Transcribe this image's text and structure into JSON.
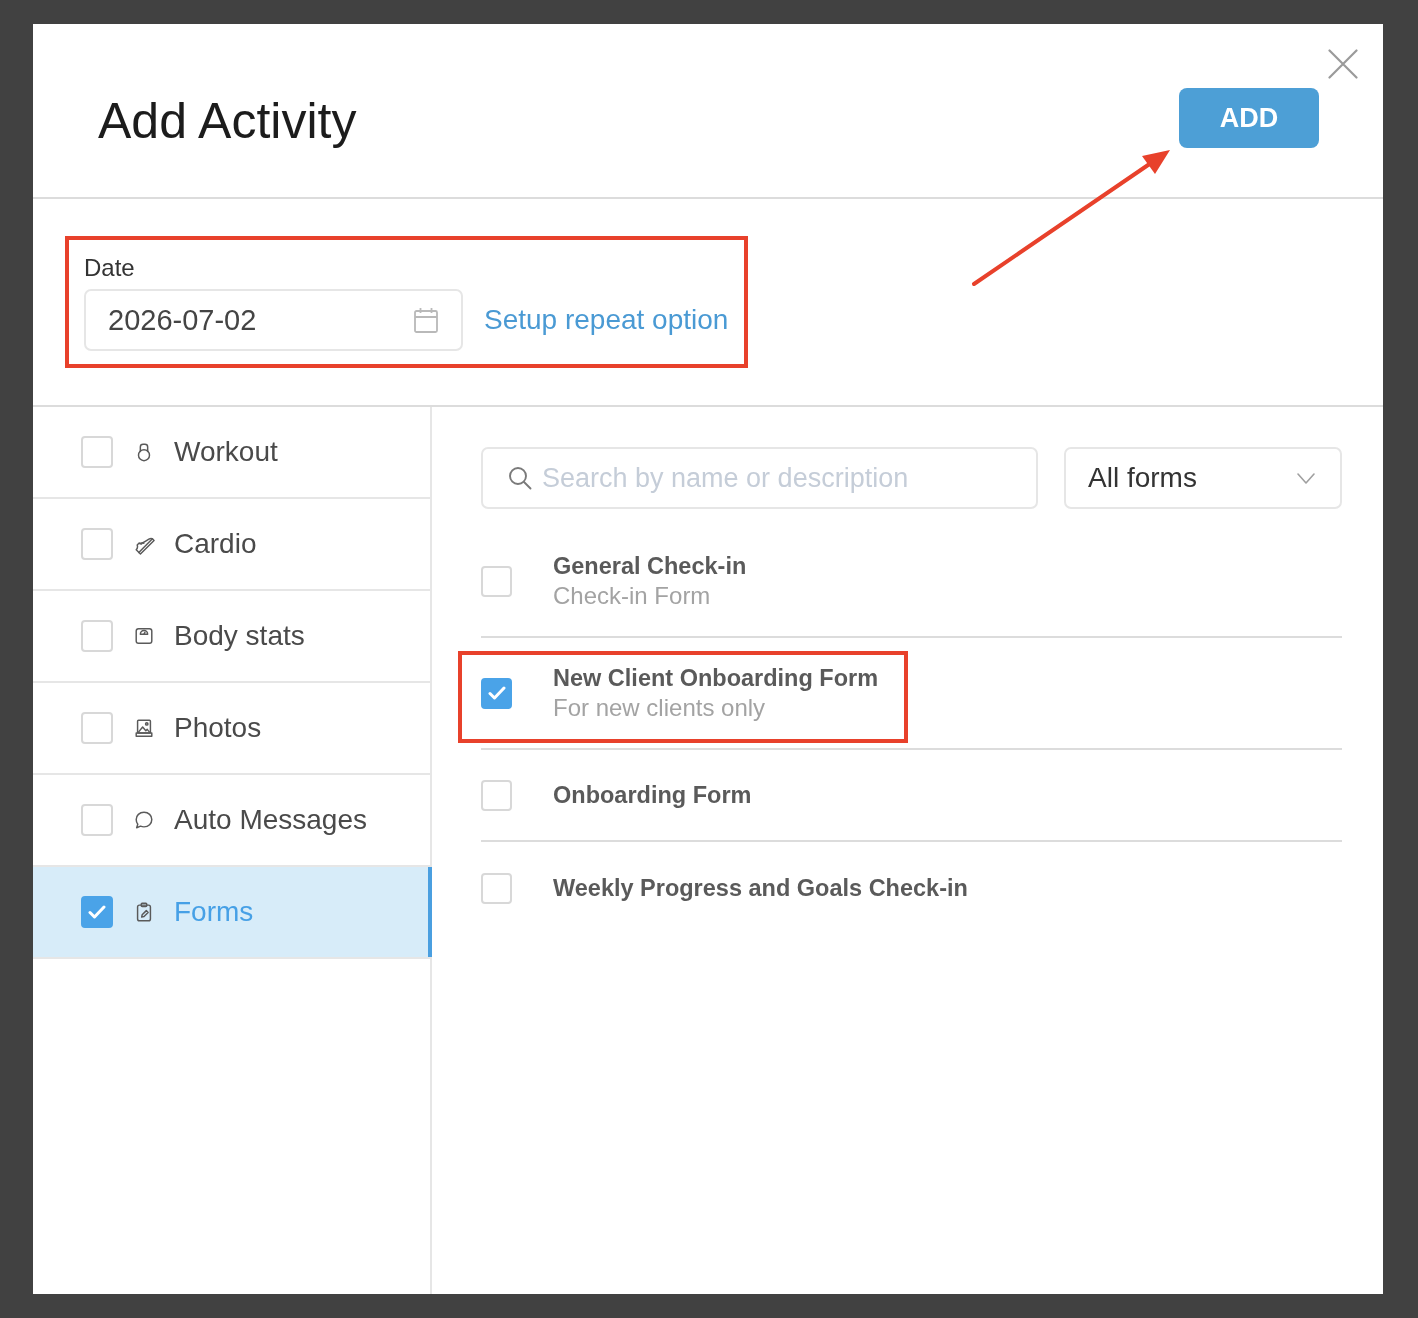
{
  "dialog": {
    "title": "Add Activity",
    "add_button": {
      "label": "ADD",
      "pointed_at": true
    }
  },
  "date_section": {
    "label": "Date",
    "value": "2026-07-02",
    "repeat_link": "Setup repeat option",
    "highlighted": true
  },
  "activity_types": [
    {
      "kind": "workout",
      "label": "Workout",
      "checked": false,
      "selected": false
    },
    {
      "kind": "cardio",
      "label": "Cardio",
      "checked": false,
      "selected": false
    },
    {
      "kind": "body_stats",
      "label": "Body stats",
      "checked": false,
      "selected": false
    },
    {
      "kind": "photos",
      "label": "Photos",
      "checked": false,
      "selected": false
    },
    {
      "kind": "messages",
      "label": "Auto Messages",
      "checked": false,
      "selected": false
    },
    {
      "kind": "forms",
      "label": "Forms",
      "checked": true,
      "selected": true
    }
  ],
  "forms_panel": {
    "search": {
      "placeholder": "Search by name or description"
    },
    "filter": {
      "value": "All forms"
    },
    "forms": [
      {
        "title": "General Check-in",
        "description": "Check-in Form",
        "checked": false,
        "highlighted": false
      },
      {
        "title": "New Client Onboarding Form",
        "description": "For new clients only",
        "checked": true,
        "highlighted": true
      },
      {
        "title": "Onboarding Form",
        "checked": false,
        "highlighted": false
      },
      {
        "title": "Weekly Progress and Goals Check-in",
        "checked": false,
        "highlighted": false
      }
    ]
  }
}
